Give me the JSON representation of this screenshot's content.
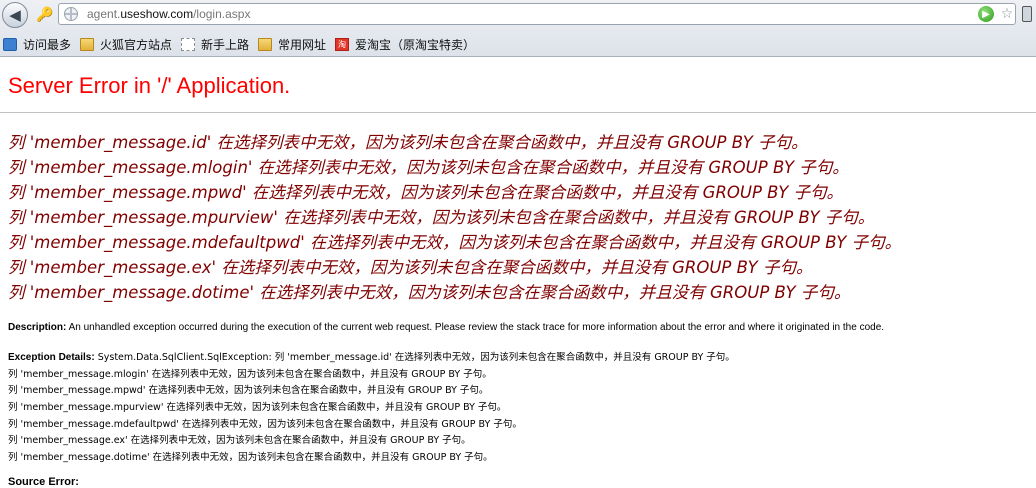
{
  "browser": {
    "url_prefix": "agent.",
    "url_domain": "useshow.com",
    "url_path": "/login.aspx",
    "back_glyph": "◀",
    "key_glyph": "🔑",
    "go_glyph": "▶",
    "star_glyph": "☆",
    "bookmarks": [
      {
        "label": "访问最多",
        "icon": "most-visited-icon"
      },
      {
        "label": "火狐官方站点",
        "icon": "folder-icon"
      },
      {
        "label": "新手上路",
        "icon": "page-icon"
      },
      {
        "label": "常用网址",
        "icon": "folder-icon"
      },
      {
        "label": "爱淘宝（原淘宝特卖）",
        "icon": "taobao-icon",
        "icon_text": "淘"
      }
    ]
  },
  "page": {
    "title": "Server Error in '/' Application.",
    "errors": [
      "列 'member_message.id' 在选择列表中无效，因为该列未包含在聚合函数中，并且没有 GROUP BY 子句。",
      "列 'member_message.mlogin' 在选择列表中无效，因为该列未包含在聚合函数中，并且没有 GROUP BY 子句。",
      "列 'member_message.mpwd' 在选择列表中无效，因为该列未包含在聚合函数中，并且没有 GROUP BY 子句。",
      "列 'member_message.mpurview' 在选择列表中无效，因为该列未包含在聚合函数中，并且没有 GROUP BY 子句。",
      "列 'member_message.mdefaultpwd' 在选择列表中无效，因为该列未包含在聚合函数中，并且没有 GROUP BY 子句。",
      "列 'member_message.ex' 在选择列表中无效，因为该列未包含在聚合函数中，并且没有 GROUP BY 子句。",
      "列 'member_message.dotime' 在选择列表中无效，因为该列未包含在聚合函数中，并且没有 GROUP BY 子句。"
    ],
    "description_label": "Description:",
    "description_text": " An unhandled exception occurred during the execution of the current web request. Please review the stack trace for more information about the error and where it originated in the code.",
    "exception_label": "Exception Details:",
    "exception_first": " System.Data.SqlClient.SqlException: 列 'member_message.id' 在选择列表中无效，因为该列未包含在聚合函数中，并且没有 GROUP BY 子句。",
    "exception_lines": [
      "列 'member_message.mlogin' 在选择列表中无效，因为该列未包含在聚合函数中，并且没有 GROUP BY 子句。",
      "列 'member_message.mpwd' 在选择列表中无效，因为该列未包含在聚合函数中，并且没有 GROUP BY 子句。",
      "列 'member_message.mpurview' 在选择列表中无效，因为该列未包含在聚合函数中，并且没有 GROUP BY 子句。",
      "列 'member_message.mdefaultpwd' 在选择列表中无效，因为该列未包含在聚合函数中，并且没有 GROUP BY 子句。",
      "列 'member_message.ex' 在选择列表中无效，因为该列未包含在聚合函数中，并且没有 GROUP BY 子句。",
      "列 'member_message.dotime' 在选择列表中无效，因为该列未包含在聚合函数中，并且没有 GROUP BY 子句。"
    ],
    "source_label": "Source Error:"
  },
  "colors": {
    "title": "#ff0000",
    "error_heading": "#800000",
    "rule": "#c0c0c0"
  }
}
